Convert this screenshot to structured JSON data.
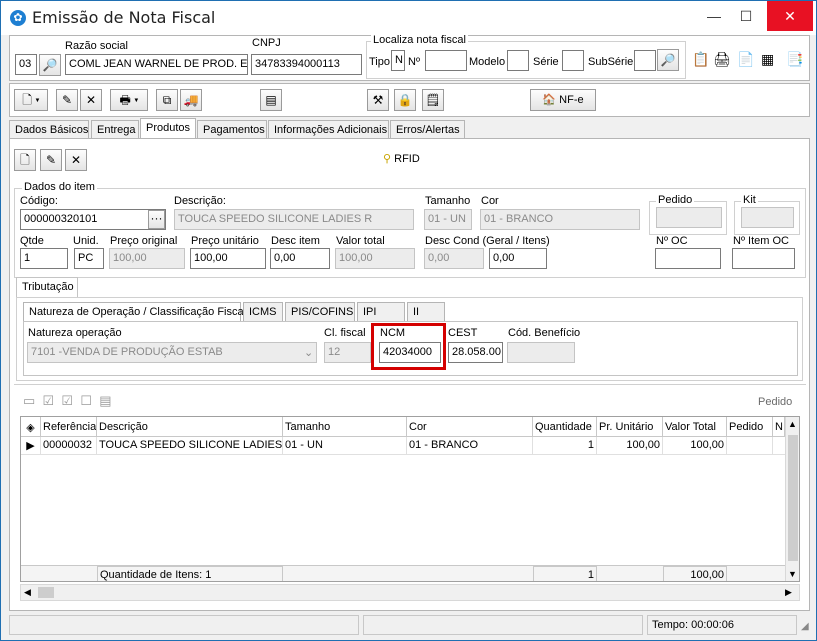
{
  "window": {
    "title": "Emissão de Nota Fiscal",
    "minimize": "—",
    "maximize": "☐",
    "close": "✕"
  },
  "header": {
    "empresa_code": "03",
    "razao_label": "Razão social",
    "razao_value": "COML JEAN WARNEL DE PROD. ESP.",
    "cnpj_label": "CNPJ",
    "cnpj_value": "34783394000113",
    "localiza_label": "Localiza nota fiscal",
    "tipo_label": "Tipo",
    "tipo_value": "N",
    "numero_label": "Nº",
    "modelo_label": "Modelo",
    "serie_label": "Série",
    "subserie_label": "SubSérie"
  },
  "toolbar": {
    "nfe_label": "NF-e"
  },
  "tabs": [
    "Dados Básicos",
    "Entrega",
    "Produtos",
    "Pagamentos",
    "Informações Adicionais",
    "Erros/Alertas"
  ],
  "products": {
    "rfid_label": "RFID",
    "group_label": "Dados do item",
    "codigo_label": "Código:",
    "codigo_value": "000000320101",
    "descricao_label": "Descrição:",
    "descricao_value": "TOUCA SPEEDO SILICONE LADIES R",
    "tamanho_label": "Tamanho",
    "tamanho_value": "01 - UN",
    "cor_label": "Cor",
    "cor_value": "01 - BRANCO",
    "pedido_label": "Pedido",
    "kit_label": "Kit",
    "qtde_label": "Qtde",
    "qtde_value": "1",
    "unid_label": "Unid.",
    "unid_value": "PC",
    "preco_orig_label": "Preço original",
    "preco_orig_value": "100,00",
    "preco_unit_label": "Preço unitário",
    "preco_unit_value": "100,00",
    "desc_item_label": "Desc item",
    "desc_item_value": "0,00",
    "valor_total_label": "Valor total",
    "valor_total_value": "100,00",
    "desc_cond_label": "Desc Cond (Geral / Itens)",
    "desc_cond_geral": "0,00",
    "desc_cond_itens": "0,00",
    "no_oc_label": "Nº OC",
    "no_item_oc_label": "Nº Item OC"
  },
  "tributacao": {
    "tab_label": "Tributação",
    "subtabs": [
      "Natureza de Operação / Classificação Fiscal",
      "ICMS",
      "PIS/COFINS",
      "IPI",
      "II"
    ],
    "natureza_label": "Natureza operação",
    "natureza_value": "7101 -VENDA DE PRODUÇÃO ESTAB",
    "cl_fiscal_label": "Cl. fiscal",
    "cl_fiscal_value": "12",
    "ncm_label": "NCM",
    "ncm_value": "42034000",
    "cest_label": "CEST",
    "cest_value": "28.058.00",
    "cod_beneficio_label": "Cód. Benefício"
  },
  "grid": {
    "pedido_btn": "Pedido",
    "columns": [
      "Referência",
      "Descrição",
      "Tamanho",
      "Cor",
      "Quantidade",
      "Pr. Unitário",
      "Valor Total",
      "Pedido",
      "N"
    ],
    "rows": [
      {
        "referencia": "00000032",
        "descricao": "TOUCA SPEEDO SILICONE LADIES R",
        "tamanho": "01 - UN",
        "cor": "01 - BRANCO",
        "quantidade": "1",
        "pr_unitario": "100,00",
        "valor_total": "100,00",
        "pedido": ""
      }
    ],
    "footer_qtd_itens": "Quantidade de Itens: 1",
    "footer_quantidade": "1",
    "footer_valor_total": "100,00"
  },
  "status": {
    "tempo": "Tempo: 00:00:06"
  },
  "colors": {
    "highlight": "#d40000",
    "close": "#e81123",
    "accent": "#1e7fd2"
  }
}
